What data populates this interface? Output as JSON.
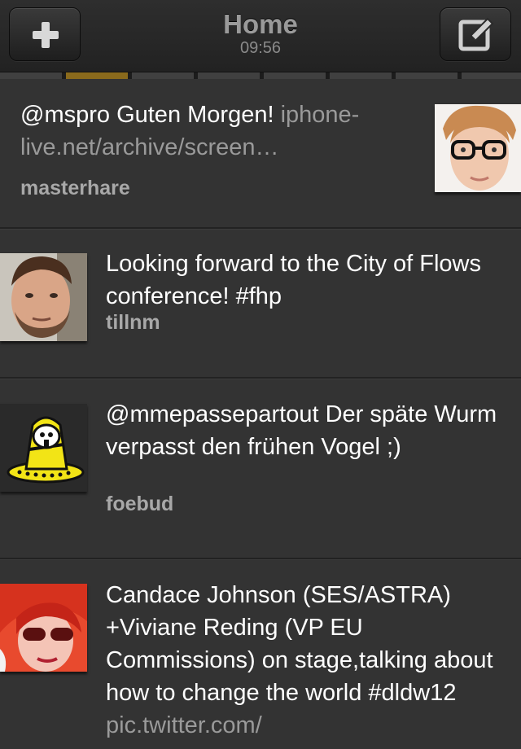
{
  "header": {
    "title": "Home",
    "time": "09:56",
    "new_button_icon": "plus-icon",
    "compose_button_icon": "compose-icon"
  },
  "tabs": {
    "count": 8,
    "active_index": 1,
    "active_color": "#8a6a1c"
  },
  "tweets": [
    {
      "text": "@mspro Guten Morgen!",
      "link": "iphone-live.net/archive/screen…",
      "username": "masterhare",
      "avatar": "avatar-man-glasses"
    },
    {
      "text": "Looking forward to the City of Flows conference! #fhp",
      "link": "",
      "username": "tillnm",
      "avatar": "avatar-man-beard"
    },
    {
      "text": "@mmepassepartout Der späte Wurm verpasst den frühen Vogel ;)",
      "link": "",
      "username": "foebud",
      "avatar": "avatar-yellow-logo"
    },
    {
      "text": "Candace Johnson (SES/ASTRA) +Viviane Reding (VP EU Commissions) on stage,talking about how to change the world #dldw12",
      "link": "pic.twitter.com/",
      "username": "",
      "avatar": "avatar-red-hair-woman"
    }
  ]
}
